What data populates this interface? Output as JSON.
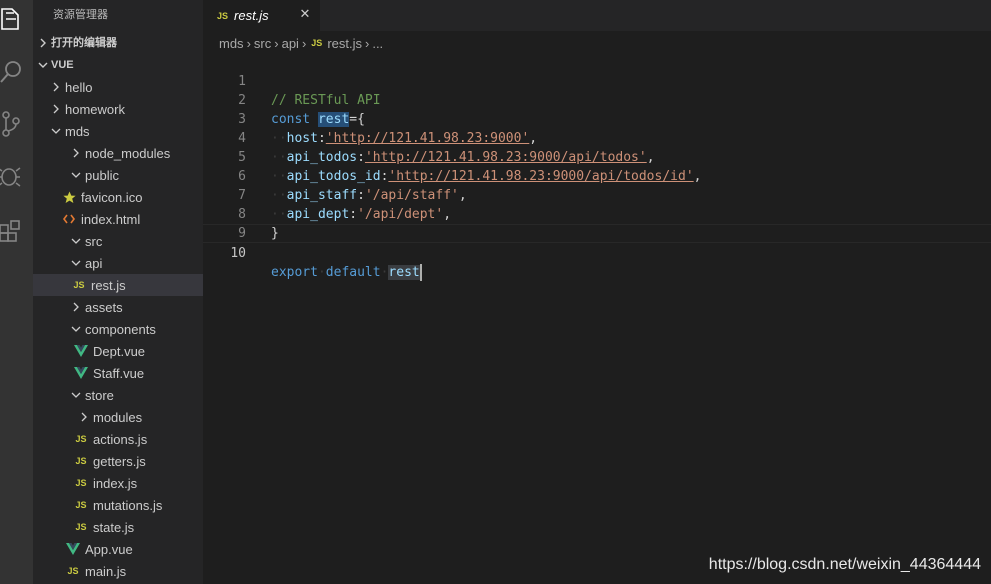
{
  "colors": {
    "activity_bar": "#333333",
    "sidebar": "#252526",
    "editor": "#1e1e1e",
    "js_icon": "#cbcb41",
    "vue_icon": "#41b883",
    "html_icon": "#e37933",
    "favicon_icon": "#cbcb41"
  },
  "activity_bar": {
    "icons": [
      "explorer-icon",
      "search-icon",
      "source-control-icon",
      "debug-icon",
      "extensions-icon"
    ]
  },
  "sidebar": {
    "title": "资源管理器",
    "open_editors_label": "打开的编辑器",
    "workspace_label": "VUE",
    "items": [
      {
        "label": "hello",
        "kind": "folder",
        "expanded": false
      },
      {
        "label": "homework",
        "kind": "folder",
        "expanded": false
      },
      {
        "label": "mds",
        "kind": "folder",
        "expanded": true
      },
      {
        "label": "node_modules",
        "kind": "folder",
        "expanded": false
      },
      {
        "label": "public",
        "kind": "folder",
        "expanded": true
      },
      {
        "label": "favicon.ico",
        "kind": "file",
        "icon": "star-icon"
      },
      {
        "label": "index.html",
        "kind": "file",
        "icon": "html-icon"
      },
      {
        "label": "src",
        "kind": "folder",
        "expanded": true
      },
      {
        "label": "api",
        "kind": "folder",
        "expanded": true
      },
      {
        "label": "rest.js",
        "kind": "file",
        "icon": "js-icon",
        "selected": true
      },
      {
        "label": "assets",
        "kind": "folder",
        "expanded": false
      },
      {
        "label": "components",
        "kind": "folder",
        "expanded": true
      },
      {
        "label": "Dept.vue",
        "kind": "file",
        "icon": "vue-icon"
      },
      {
        "label": "Staff.vue",
        "kind": "file",
        "icon": "vue-icon"
      },
      {
        "label": "store",
        "kind": "folder",
        "expanded": true
      },
      {
        "label": "modules",
        "kind": "folder",
        "expanded": false
      },
      {
        "label": "actions.js",
        "kind": "file",
        "icon": "js-icon"
      },
      {
        "label": "getters.js",
        "kind": "file",
        "icon": "js-icon"
      },
      {
        "label": "index.js",
        "kind": "file",
        "icon": "js-icon"
      },
      {
        "label": "mutations.js",
        "kind": "file",
        "icon": "js-icon"
      },
      {
        "label": "state.js",
        "kind": "file",
        "icon": "js-icon"
      },
      {
        "label": "App.vue",
        "kind": "file",
        "icon": "vue-icon"
      },
      {
        "label": "main.js",
        "kind": "file",
        "icon": "js-icon"
      }
    ],
    "js_badge": "JS"
  },
  "tab": {
    "badge": "JS",
    "label": "rest.js",
    "close": "✕"
  },
  "breadcrumb": {
    "parts": [
      "mds",
      "src",
      "api"
    ],
    "badge": "JS",
    "file": "rest.js",
    "more": "..."
  },
  "code": {
    "line_numbers": [
      "1",
      "2",
      "3",
      "4",
      "5",
      "6",
      "7",
      "8",
      "9",
      "10"
    ],
    "comment": "// RESTful API",
    "const_kw": "const",
    "var_name": "rest",
    "assign_open": "={",
    "host_key": "host",
    "host_val": "'http://121.41.98.23:9000'",
    "todos_key": "api_todos",
    "todos_val": "'http://121.41.98.23:9000/api/todos'",
    "todos_id_key": "api_todos_id",
    "todos_id_val": "'http://121.41.98.23:9000/api/todos/id'",
    "staff_key": "api_staff",
    "staff_val": "'/api/staff'",
    "dept_key": "api_dept",
    "dept_val": "'/api/dept'",
    "close_brace": "}",
    "export_kw": "export",
    "default_kw": "default",
    "export_var": "rest",
    "colon": ":",
    "comma": ","
  },
  "watermark": "https://blog.csdn.net/weixin_44364444"
}
